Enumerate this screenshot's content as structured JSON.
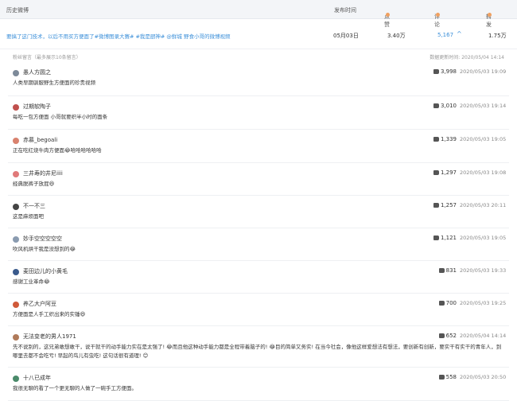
{
  "header": {
    "title": "历史微博",
    "time": "发布时间",
    "likes": "点赞",
    "comments": "评论",
    "reposts": "转发"
  },
  "post": {
    "title": "要搞了这门技术，以后不用买方便面了#微博图录大赛# #我是厨神# @鲜城 野食小哥的微博视频",
    "date": "05月03日",
    "likes": "3.40万",
    "comments": "5,167",
    "reposts": "1.75万"
  },
  "comments_section": {
    "label": "粉丝留言（最多展示10条留言）",
    "updated": "数据更新时间: 2020/05/04 14:14",
    "items": [
      {
        "user": "愚人方圆之",
        "text": "人类早期驯服野生方便面的珍贵视频",
        "likes": "3,998",
        "time": "2020/05/03 19:09",
        "avatar_color": "#7d8a99"
      },
      {
        "user": "过期软陶子",
        "text": "每吃一包方便面 小哥就要织半小时的面条",
        "likes": "3,010",
        "time": "2020/05/03 19:14",
        "avatar_color": "#c0504d"
      },
      {
        "user": "赤慕_begoali",
        "text": "正在吃红烧牛肉方便面😂哈哈哈哈哈哈",
        "likes": "1,339",
        "time": "2020/05/03 19:05",
        "avatar_color": "#d9826e"
      },
      {
        "user": "三井寿的井尼iiii",
        "text": "经典脱裤子放屁😆",
        "likes": "1,297",
        "time": "2020/05/03 19:08",
        "avatar_color": "#e07a7a"
      },
      {
        "user": "不一不三",
        "text": "这是麻烦面吧",
        "likes": "1,257",
        "time": "2020/05/03 20:11",
        "avatar_color": "#444444"
      },
      {
        "user": "妙手空空空空空",
        "text": "吹风机烘干我是没想到的😂",
        "likes": "1,121",
        "time": "2020/05/03 19:05",
        "avatar_color": "#8a9bb0"
      },
      {
        "user": "麦田边儿的小黄毛",
        "text": "感谢工业革命😂",
        "likes": "831",
        "time": "2020/05/03 19:33",
        "avatar_color": "#3a5a8c"
      },
      {
        "user": "养乙大户阿豆",
        "text": "方便面是人手工织出来的实锤😆",
        "likes": "700",
        "time": "2020/05/03 19:25",
        "avatar_color": "#d05a3a"
      },
      {
        "user": "无法变老的男人1971",
        "text": "先不说别的，这兄弟敢想敢干，说干就干的动手能力实在是太强了! 😂而且他这种动手能力都是全程带着脑子的! 😂目的简单又务实! 在当今社会，像他这样爱想法有想法，要创新有创新，要实干有实干的青年人，到哪里去都不会吃亏! 早起的鸟儿有虫吃! 这句话很有道理! 😊",
        "likes": "652",
        "time": "2020/05/04 14:14",
        "avatar_color": "#b07a5a"
      },
      {
        "user": "十八已成年",
        "text": "我很无聊的看了一个更无聊的人做了一碗手工方便面。",
        "likes": "558",
        "time": "2020/05/03 20:50",
        "avatar_color": "#4a8a6a"
      }
    ]
  },
  "colors": {
    "link": "#3b8fd9",
    "header_bg": "#f3f5f8",
    "sort_icon": "#f0a060"
  }
}
